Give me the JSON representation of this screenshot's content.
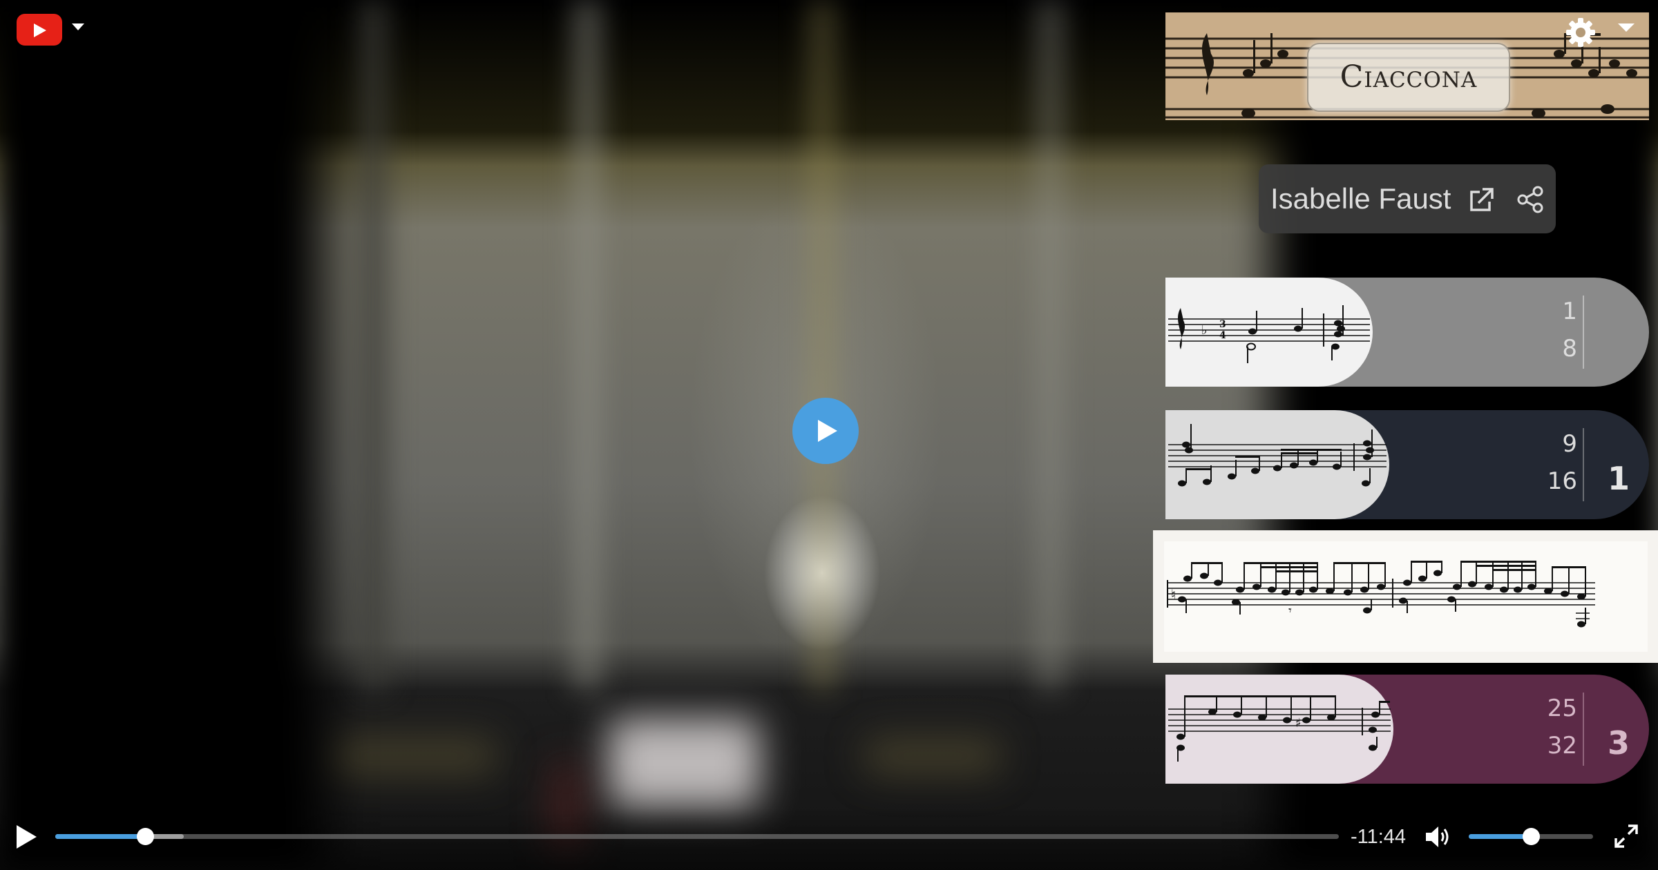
{
  "player": {
    "logo": "youtube-logo",
    "title_banner": "Ciaccona",
    "performer": "Isabelle Faust",
    "time_remaining": "-11:44",
    "progress": 0.07,
    "buffered": 0.1,
    "volume": 0.5
  },
  "sections": [
    {
      "range_start": "1",
      "range_end": "8",
      "number": ""
    },
    {
      "range_start": "9",
      "range_end": "16",
      "number": "1"
    },
    {
      "range_start": "",
      "range_end": "",
      "number": ""
    },
    {
      "range_start": "25",
      "range_end": "32",
      "number": "3"
    }
  ],
  "icons": {
    "settings": "gear-icon",
    "external": "external-link-icon",
    "share": "share-icon",
    "play": "play-icon",
    "volume": "volume-icon",
    "fullscreen": "fullscreen-icon"
  },
  "colors": {
    "accent": "#4a9fe0",
    "youtube_red": "#e62117",
    "section_gray": "#8a8a8a",
    "section_navy": "#232833",
    "section_plum": "#5c2a47"
  }
}
